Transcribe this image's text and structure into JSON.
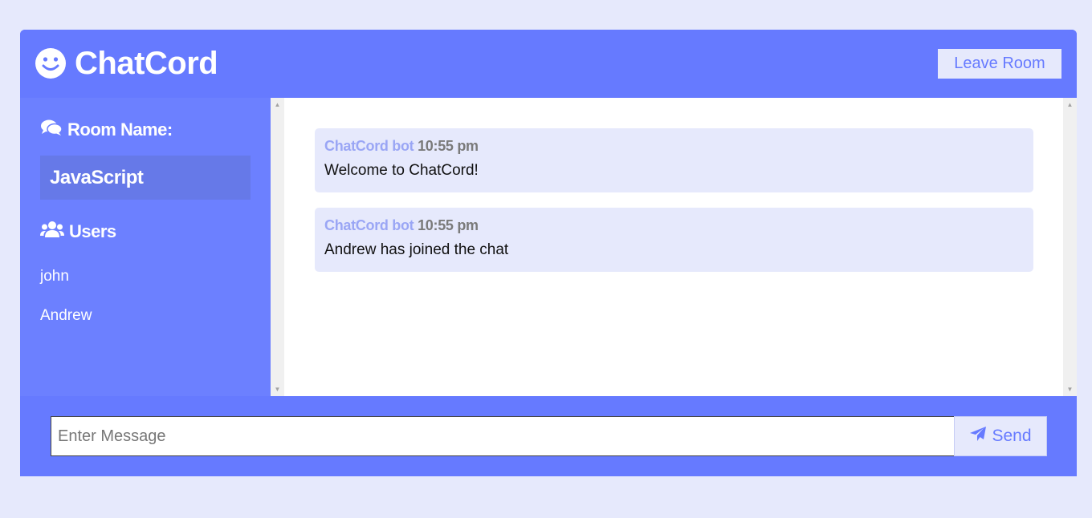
{
  "header": {
    "logo_icon": "smile-icon",
    "title": "ChatCord",
    "leave_label": "Leave Room"
  },
  "sidebar": {
    "room_heading_icon": "comments-icon",
    "room_heading": "Room Name:",
    "room_name": "JavaScript",
    "users_heading_icon": "users-icon",
    "users_heading": "Users",
    "users": [
      "john",
      "Andrew"
    ]
  },
  "messages": [
    {
      "author": "ChatCord bot",
      "time": "10:55 pm",
      "text": "Welcome to ChatCord!"
    },
    {
      "author": "ChatCord bot",
      "time": "10:55 pm",
      "text": "Andrew has joined the chat"
    }
  ],
  "composer": {
    "placeholder": "Enter Message",
    "value": "",
    "send_icon": "paper-plane-icon",
    "send_label": "Send"
  },
  "colors": {
    "primary": "#667aff",
    "sidebar": "#6c80ff",
    "room_box": "#6679e8",
    "light": "#e6e9fc",
    "author": "#9aa6f5"
  }
}
